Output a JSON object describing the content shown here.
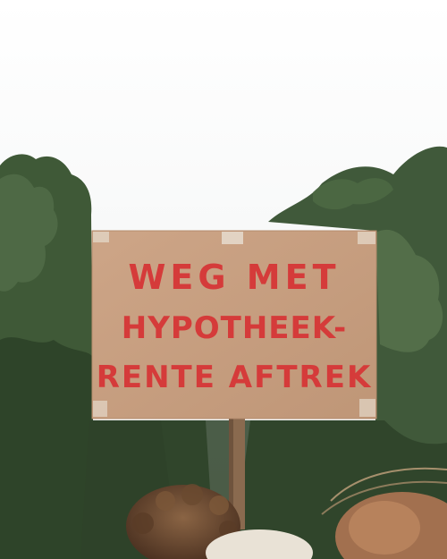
{
  "sign": {
    "line1": "WEG MET",
    "line2": "HYPOTHEEK-",
    "line3": "RENTE AFTREK"
  },
  "colors": {
    "sky": "#f6f7f7",
    "foliage": "#3d5634",
    "cardboard": "#c59c7d",
    "lettering": "#d53b3a",
    "pole": "#8a6a4f",
    "hair": "#6b4a32"
  }
}
